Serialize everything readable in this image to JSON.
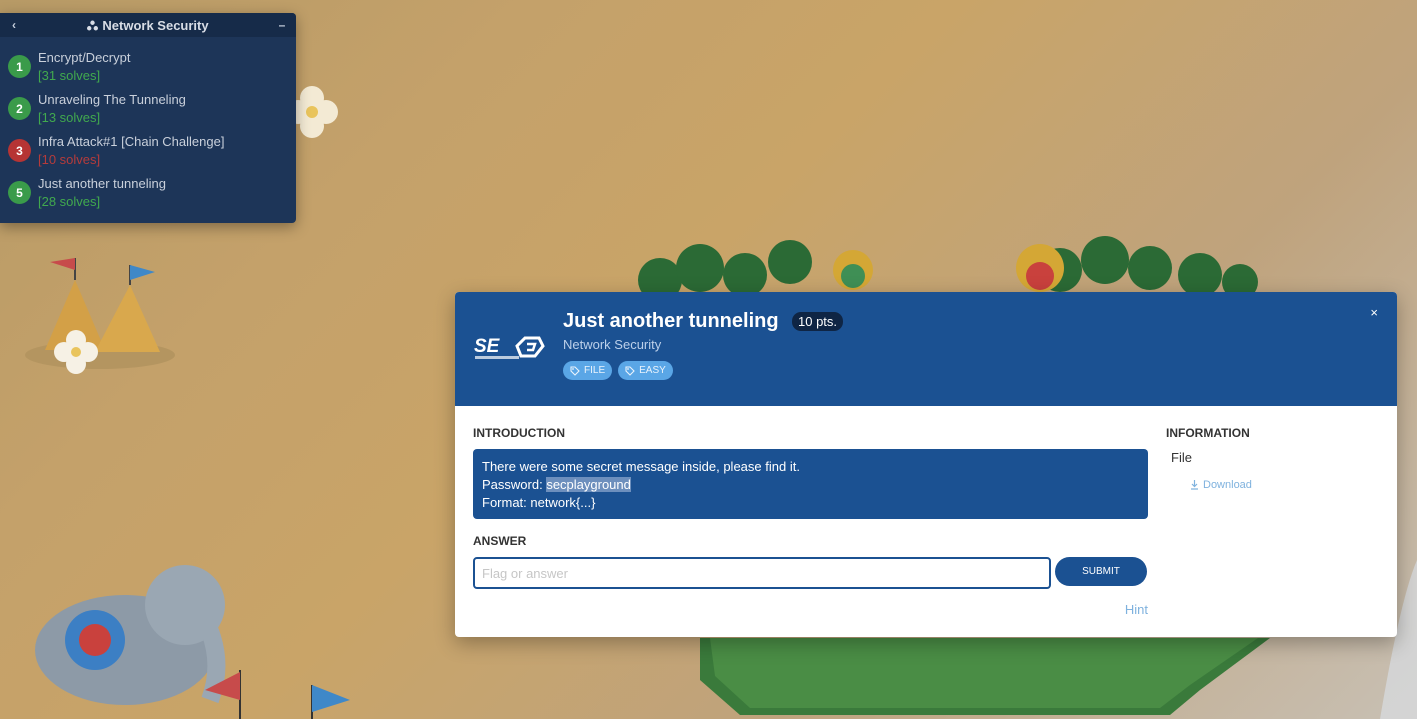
{
  "sidebar": {
    "title": "Network Security",
    "collapse_label": "‹",
    "minimize_label": "–",
    "challenges": [
      {
        "num": "1",
        "name": "Encrypt/Decrypt",
        "solves": "[31 solves]",
        "status": "green"
      },
      {
        "num": "2",
        "name": "Unraveling The Tunneling",
        "solves": "[13 solves]",
        "status": "green"
      },
      {
        "num": "3",
        "name": "Infra Attack#1 [Chain Challenge]",
        "solves": "[10 solves]",
        "status": "red"
      },
      {
        "num": "5",
        "name": "Just another tunneling",
        "solves": "[28 solves]",
        "status": "green"
      }
    ]
  },
  "modal": {
    "title": "Just another tunneling",
    "points": "10 pts.",
    "category": "Network Security",
    "tags": [
      "FILE",
      "EASY"
    ],
    "close_label": "×",
    "intro_label": "INTRODUCTION",
    "intro_line1": "There were some secret message inside, please find it.",
    "intro_line2_prefix": "Password: ",
    "intro_password": "secplayground",
    "intro_line3": "Format: network{...}",
    "answer_label": "ANSWER",
    "answer_placeholder": "Flag or answer",
    "submit_label": "SUBMIT",
    "hint_label": "Hint",
    "info_label": "INFORMATION",
    "info_file": "File",
    "download_label": "Download"
  },
  "colors": {
    "primary": "#1b5192",
    "success": "#3a9b4a",
    "danger": "#b63434"
  }
}
